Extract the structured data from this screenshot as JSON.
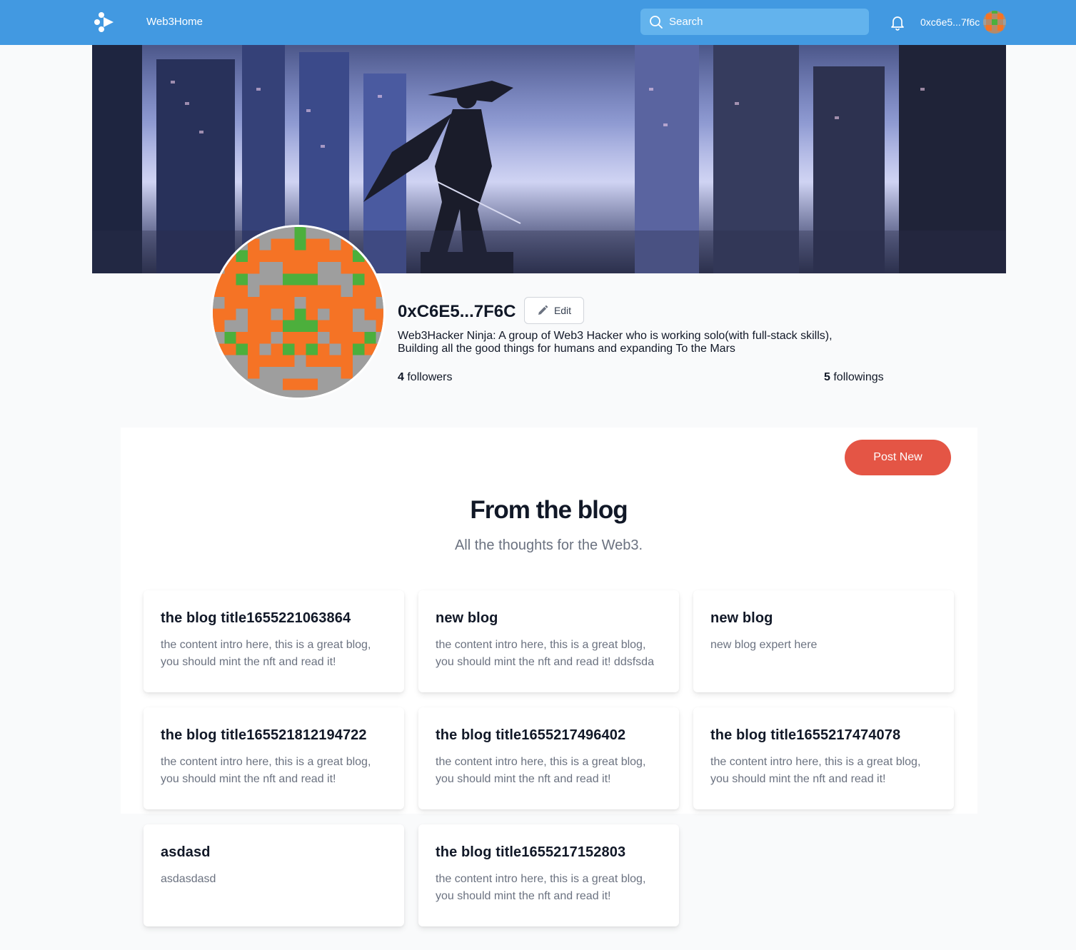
{
  "header": {
    "brand": "Web3Home",
    "search_placeholder": "Search",
    "account": "0xc6e5...7f6c"
  },
  "profile": {
    "name": "0xC6E5...7F6C",
    "edit_label": "Edit",
    "bio_line1": "Web3Hacker Ninja: A group of Web3 Hacker who is working solo(with full-stack skills),",
    "bio_line2": "Building all the good things for humans and expanding To the Mars",
    "followers_count": "4",
    "followers_label": "followers",
    "followings_count": "5",
    "followings_label": "followings"
  },
  "blog": {
    "post_new_label": "Post New",
    "title": "From the blog",
    "subtitle": "All the thoughts for the Web3.",
    "cards": [
      {
        "title": "the blog title1655221063864",
        "intro": "the content intro here, this is a great blog, you should mint the nft and read it!"
      },
      {
        "title": "new blog",
        "intro": "the content intro here, this is a great blog, you should mint the nft and read it! ddsfsda"
      },
      {
        "title": "new blog",
        "intro": "new blog expert here"
      },
      {
        "title": "the blog title165521812194722",
        "intro": "the content intro here, this is a great blog, you should mint the nft and read it!"
      },
      {
        "title": "the blog title1655217496402",
        "intro": "the content intro here, this is a great blog, you should mint the nft and read it!"
      },
      {
        "title": "the blog title1655217474078",
        "intro": "the content intro here, this is a great blog, you should mint the nft and read it!"
      },
      {
        "title": "asdasd",
        "intro": "asdasdasd"
      },
      {
        "title": "the blog title1655217152803",
        "intro": "the content intro here, this is a great blog, you should mint the nft and read it!"
      }
    ]
  },
  "icons": {
    "logo": "web3home-logo-icon",
    "search": "search-icon",
    "notifications": "bell-icon",
    "edit": "pencil-icon"
  },
  "colors": {
    "header_bg": "#4299e1",
    "search_bg": "#63b3ed",
    "post_button": "#e45545",
    "avatar_orange": "#f57325",
    "avatar_green": "#4caf3c",
    "avatar_gray": "#9e9e9e"
  }
}
